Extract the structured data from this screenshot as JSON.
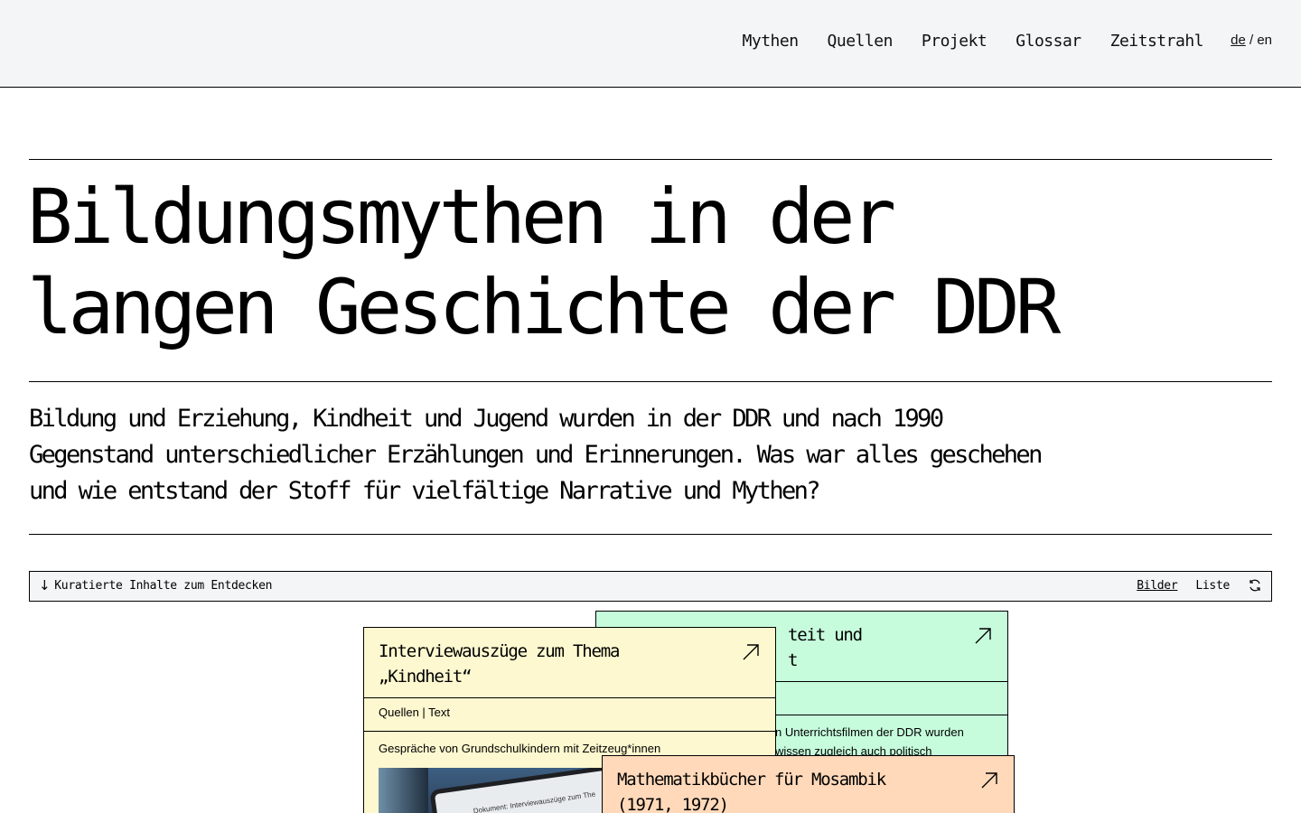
{
  "nav": {
    "items": [
      "Mythen",
      "Quellen",
      "Projekt",
      "Glossar",
      "Zeitstrahl"
    ],
    "lang_active": "de",
    "lang_sep": "/",
    "lang_other": "en"
  },
  "hero": {
    "title_line1": "Bildungsmythen in der",
    "title_line2": "langen Geschichte der DDR",
    "intro_line1": "Bildung und Erziehung, Kindheit und Jugend wurden in der DDR und nach 1990",
    "intro_line2": "Gegenstand unterschiedlicher Erzählungen und Erinnerungen. Was war alles geschehen",
    "intro_line3": "und wie entstand der Stoff für vielfältige Narrative und Mythen?"
  },
  "filter": {
    "label": "Kuratierte Inhalte zum Entdecken",
    "view_images": "Bilder",
    "view_list": "Liste",
    "arrow_icon": "arrow-down-icon",
    "refresh_icon": "refresh-icon"
  },
  "cards": {
    "green": {
      "title_line1": "teit und",
      "title_line2": "t",
      "meta": "",
      "desc_line1": "n Unterrichtsfilmen der DDR wurden",
      "desc_line2": "wissen zugleich auch politisch",
      "color": "#c6fcdc"
    },
    "yellow": {
      "title_line1": "Interviewauszüge zum Thema",
      "title_line2": "„Kindheit“",
      "meta": "Quellen | Text",
      "desc": "Gespräche von Grundschulkindern mit Zeitzeug*innen",
      "thumb_text": "Dokument: Interviewauszüge zum The",
      "color": "#fdf8cf"
    },
    "orange": {
      "title_line1": "Mathematikbücher für Mosambik",
      "title_line2": "(1971, 1972)",
      "color": "#ffd9ba"
    }
  }
}
